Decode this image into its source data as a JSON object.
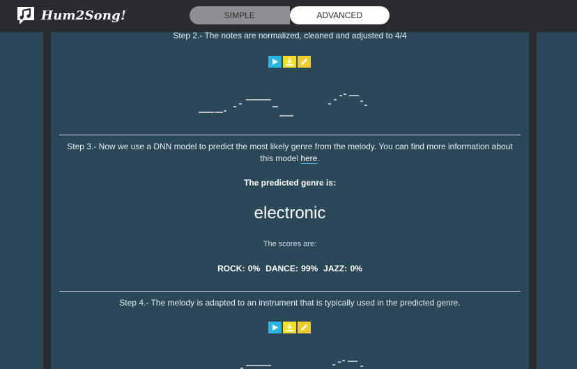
{
  "app": {
    "name": "Hum2Song!"
  },
  "mode_toggle": {
    "simple_label": "SIMPLE",
    "advanced_label": "ADVANCED",
    "selected": "ADVANCED"
  },
  "steps": {
    "step2_text": "Step 2.- The notes are normalized, cleaned and adjusted to 4/4",
    "step3_text_before_link": "Step 3.- Now we use a DNN model to predict the most likely genre from the melody. You can find more information about this model ",
    "step3_link_text": "here",
    "step3_text_after_link": ".",
    "predicted_label": "The predicted genre is:",
    "predicted_genre": "electronic",
    "scores_label": "The scores are:",
    "scores": [
      {
        "text": "ROCK: 0%"
      },
      {
        "text": "DANCE: 99%"
      },
      {
        "text": "JAZZ: 0%"
      }
    ],
    "step4_text": "Step 4.- The melody is adapted to an instrument that is typically used in the predicted genre."
  },
  "icons": {
    "play": "play-icon",
    "download": "download-icon",
    "edit": "pencil-icon"
  },
  "colors": {
    "panel_bg": "#2b4858",
    "topbar_bg": "#2a2b30",
    "play_btn": "#28b5e6",
    "download_btn": "#f0e02c",
    "edit_btn": "#f0cc2b",
    "link_underline": "#36c0ff"
  }
}
